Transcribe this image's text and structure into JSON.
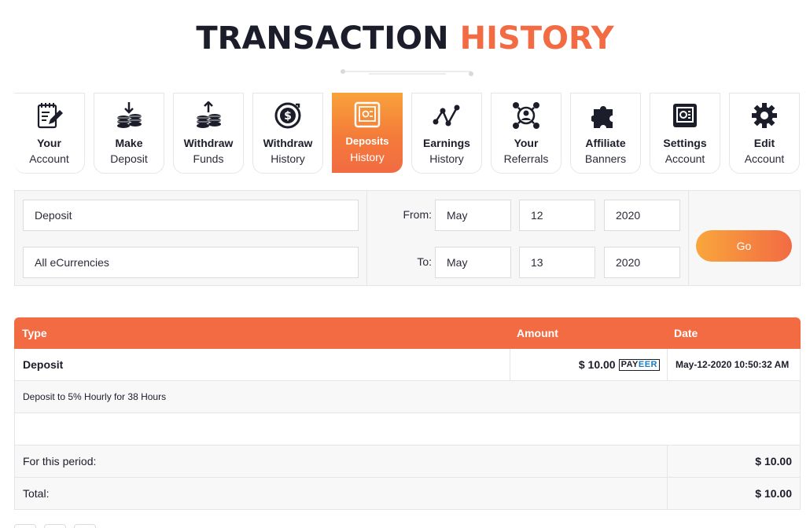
{
  "title": {
    "main": "TRANSACTION",
    "accent": "HISTORY"
  },
  "nav": [
    {
      "line1": "Your",
      "line2": "Account",
      "icon": "notepad-pen-icon"
    },
    {
      "line1": "Make",
      "line2": "Deposit",
      "icon": "coins-down-icon"
    },
    {
      "line1": "Withdraw",
      "line2": "Funds",
      "icon": "coins-up-icon"
    },
    {
      "line1": "Withdraw",
      "line2": "History",
      "icon": "dollar-refresh-icon"
    },
    {
      "line1": "Deposits",
      "line2": "History",
      "icon": "safe-icon",
      "active": true
    },
    {
      "line1": "Earnings",
      "line2": "History",
      "icon": "line-chart-icon"
    },
    {
      "line1": "Your",
      "line2": "Referrals",
      "icon": "network-user-icon"
    },
    {
      "line1": "Affiliate",
      "line2": "Banners",
      "icon": "puzzle-icon"
    },
    {
      "line1": "Settings",
      "line2": "Account",
      "icon": "settings-panel-icon"
    },
    {
      "line1": "Edit",
      "line2": "Account",
      "icon": "gear-icon"
    }
  ],
  "filter": {
    "type_value": "Deposit",
    "currency_value": "All eCurrencies",
    "from_label": "From:",
    "to_label": "To:",
    "from": {
      "month": "May",
      "day": "12",
      "year": "2020"
    },
    "to": {
      "month": "May",
      "day": "13",
      "year": "2020"
    },
    "go_label": "Go"
  },
  "table": {
    "headers": {
      "type": "Type",
      "amount": "Amount",
      "date": "Date"
    },
    "row": {
      "type": "Deposit",
      "amount": "$ 10.00",
      "processor_a": "PAY",
      "processor_b": "EER",
      "date": "May-12-2020 10:50:32 AM"
    },
    "detail": "Deposit to 5% Hourly for 38 Hours",
    "period_label": "For this period:",
    "period_value": "$ 10.00",
    "total_label": "Total:",
    "total_value": "$ 10.00"
  },
  "colors": {
    "accent": "#f26b43",
    "accent_light": "#f9a63c",
    "dark": "#1c1d2b"
  }
}
